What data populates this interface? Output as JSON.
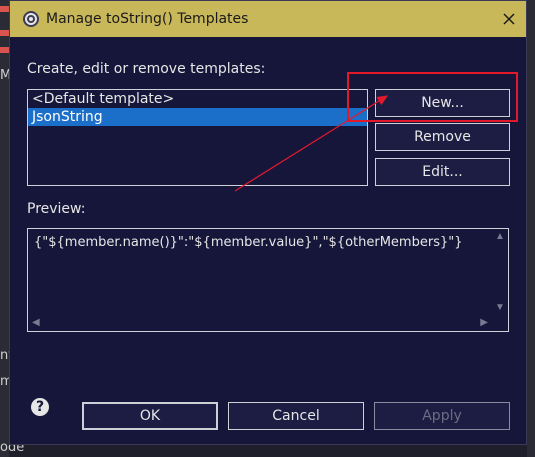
{
  "background": {
    "left_text_1": "M",
    "left_text_2": "nt",
    "left_text_3": "m",
    "left_text_4": "ode"
  },
  "dialog": {
    "title": "Manage toString() Templates",
    "instruction": "Create, edit or remove templates:",
    "templates": [
      {
        "label": "<Default template>",
        "selected": false
      },
      {
        "label": "JsonString",
        "selected": true
      }
    ],
    "buttons": {
      "new": "New...",
      "remove": "Remove",
      "edit": "Edit...",
      "ok": "OK",
      "cancel": "Cancel",
      "apply": "Apply"
    },
    "preview_label": "Preview:",
    "preview_text": "{\"${member.name()}\":\"${member.value}\",\"${otherMembers}\"}",
    "help": "?"
  },
  "colors": {
    "titlebar": "#c9b85a",
    "dialog_bg": "#16163b",
    "selection": "#1c6fc8",
    "annotation": "#e2192b"
  }
}
